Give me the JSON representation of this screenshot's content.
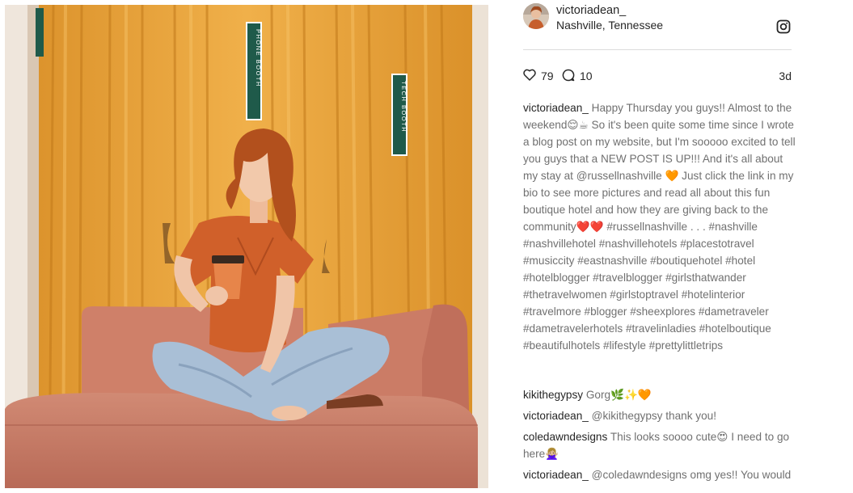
{
  "post": {
    "username": "victoriadean_",
    "location": "Nashville, Tennessee",
    "likes": "79",
    "comments_count": "10",
    "age": "3d",
    "caption_text": "Happy Thursday you guys!! Almost to the weekend😌☕ So it's been quite some time since I wrote a blog post on my website, but I'm sooooo excited to tell you guys that a NEW POST IS UP!!! And it's all about my stay at @russellnashville 🧡 Just click the link in my bio to see more pictures and read all about this fun boutique hotel and how they are giving back to the community❤️❤️ #russellnashville . . . #nashville #nashvillehotel #nashvillehotels #placestotravel #musiccity #eastnashville #boutiquehotel #hotel #hotelblogger #travelblogger #girlsthatwander #thetravelwomen #girlstoptravel #hotelinterior #travelmore #blogger #sheexplores #dametraveler #dametravelerhotels #travelinladies #hotelboutique #beautifulhotels #lifestyle #prettylittletrips"
  },
  "photo": {
    "sign_left": "PHONE BOOTH",
    "sign_right": "TECH BOOTH"
  },
  "comments": [
    {
      "user": "kikithegypsy",
      "text": "Gorg🌿✨🧡"
    },
    {
      "user": "victoriadean_",
      "text": "@kikithegypsy thank you!"
    },
    {
      "user": "coledawndesigns",
      "text": "This looks soooo cute😍 I need to go here🙅🏼‍♀️"
    },
    {
      "user": "victoriadean_",
      "text": "@coledawndesigns omg yes!! You would"
    }
  ],
  "icons": {
    "like": "heart-outline-icon",
    "comment": "speech-bubble-icon",
    "instagram": "instagram-logo-icon"
  },
  "colors": {
    "text_dark": "#262626",
    "text_muted": "#707070",
    "divider": "#dbdbdb",
    "curtain": "#e9a43a",
    "sofa": "#c97b66"
  }
}
